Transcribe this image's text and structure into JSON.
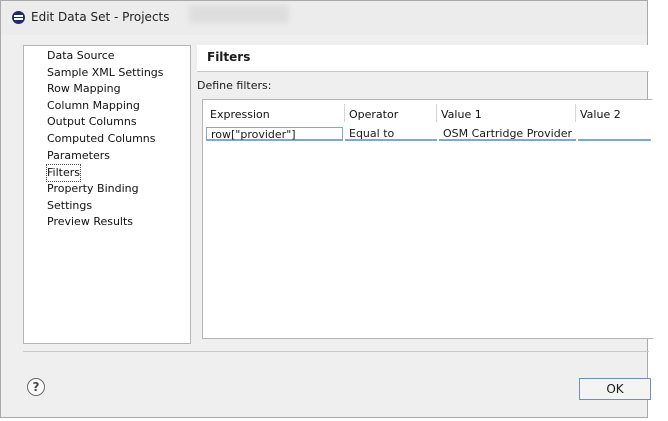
{
  "window": {
    "title": "Edit Data Set - Projects"
  },
  "nav": {
    "items": [
      {
        "label": "Data Source"
      },
      {
        "label": "Sample XML Settings"
      },
      {
        "label": "Row Mapping"
      },
      {
        "label": "Column Mapping"
      },
      {
        "label": "Output Columns"
      },
      {
        "label": "Computed Columns"
      },
      {
        "label": "Parameters"
      },
      {
        "label": "Filters"
      },
      {
        "label": "Property Binding"
      },
      {
        "label": "Settings"
      },
      {
        "label": "Preview Results"
      }
    ],
    "selected": "Filters"
  },
  "content": {
    "heading": "Filters",
    "define_label": "Define filters:",
    "table": {
      "headers": [
        "Expression",
        "Operator",
        "Value 1",
        "Value 2"
      ],
      "rows": [
        [
          "row[\"provider\"]",
          "Equal to",
          "OSM Cartridge Provider",
          ""
        ]
      ]
    }
  },
  "footer": {
    "help_icon": "help-icon",
    "help_glyph": "?",
    "ok_label": "OK"
  },
  "colors": {
    "selection_border": "#7da7d9",
    "window_bg": "#efefef",
    "title_icon": "#1f2a6b"
  }
}
